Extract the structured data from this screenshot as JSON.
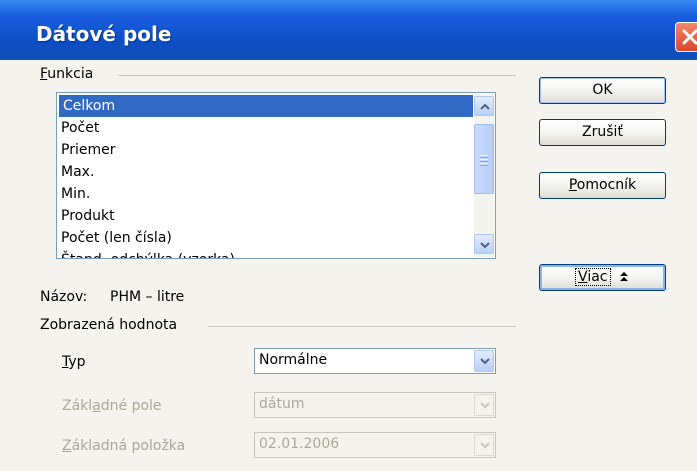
{
  "window": {
    "title": "Dátové pole"
  },
  "function_group": {
    "label": "Funkcia",
    "items": [
      "Celkom",
      "Počet",
      "Priemer",
      "Max.",
      "Min.",
      "Produkt",
      "Počet (len čísla)",
      "Štand. odchýlka (vzorka)"
    ],
    "selected": "Celkom"
  },
  "name": {
    "label": "Názov:",
    "value": "PHM – litre"
  },
  "displayed_value_group": {
    "label": "Zobrazená hodnota",
    "type_label": "Typ",
    "type_value": "Normálne",
    "base_field_label": "Základné pole",
    "base_field_value": "dátum",
    "base_item_label": "Základná položka",
    "base_item_value": "02.01.2006"
  },
  "buttons": {
    "ok": "OK",
    "cancel": "Zrušiť",
    "help": "Pomocník",
    "more": "Viac"
  },
  "colors": {
    "title_bar": "#0d4ec6",
    "selection": "#316ac5",
    "dialog_bg": "#f4f3ee",
    "disabled_text": "#aca899"
  }
}
